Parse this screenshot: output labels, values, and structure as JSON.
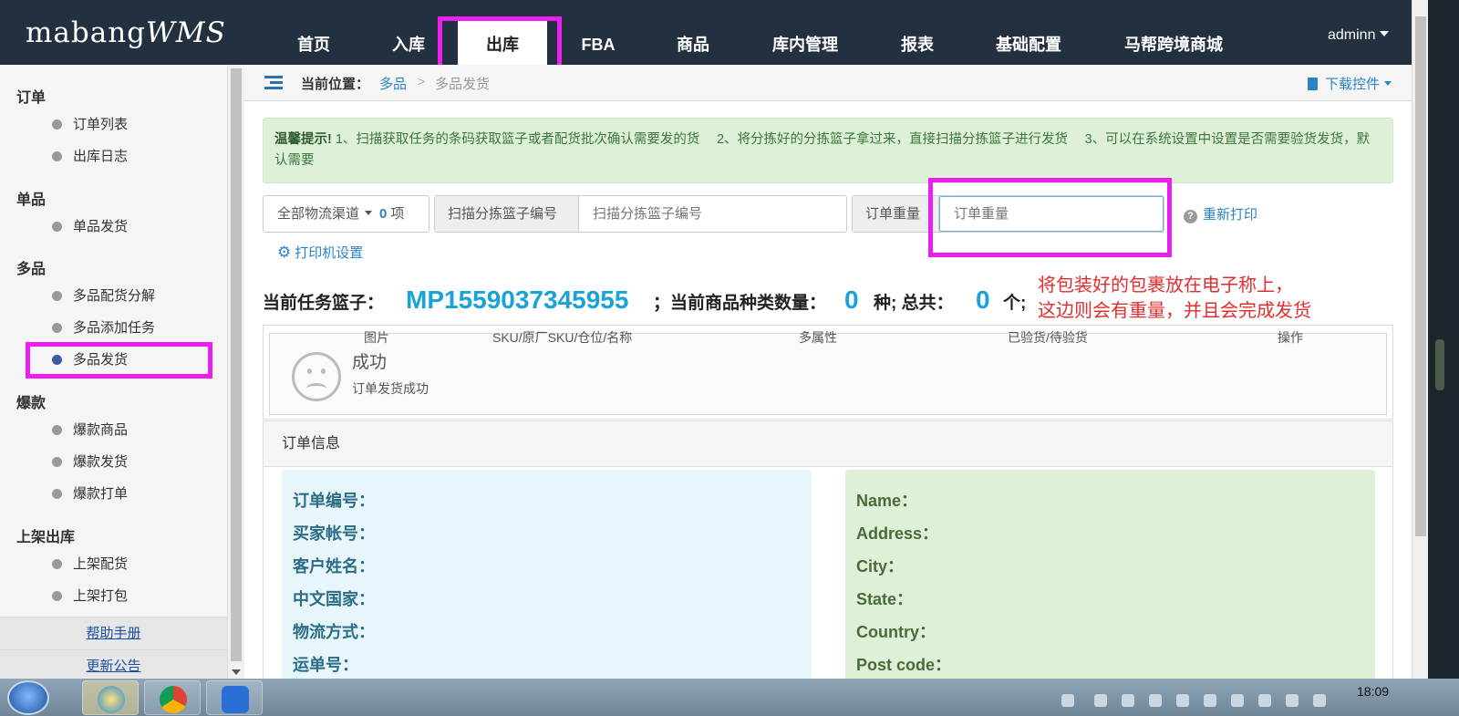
{
  "app": {
    "logo_text": "mabang",
    "logo_italic": "WMS"
  },
  "nav": {
    "items": [
      "首页",
      "入库",
      "出库",
      "FBA",
      "商品",
      "库内管理",
      "报表",
      "基础配置",
      "马帮跨境商城"
    ],
    "active": "出库",
    "user": "adminn"
  },
  "sidebar": {
    "sections": [
      {
        "title": "订单",
        "items": [
          "订单列表",
          "出库日志"
        ]
      },
      {
        "title": "单品",
        "items": [
          "单品发货"
        ]
      },
      {
        "title": "多品",
        "items": [
          "多品配货分解",
          "多品添加任务",
          "多品发货"
        ]
      },
      {
        "title": "爆款",
        "items": [
          "爆款商品",
          "爆款发货",
          "爆款打单"
        ]
      },
      {
        "title": "上架出库",
        "items": [
          "上架配货",
          "上架打包"
        ]
      }
    ],
    "selected": "多品发货",
    "links": [
      "帮助手册",
      "更新公告"
    ]
  },
  "breadcrumb": {
    "label": "当前位置：",
    "items": [
      "多品",
      "多品发货"
    ],
    "separator": ">",
    "download": "下载控件"
  },
  "tip": {
    "title": "温馨提示!",
    "text": " 1、扫描获取任务的条码获取篮子或者配货批次确认需要发的货　 2、将分拣好的分拣篮子拿过来，直接扫描分拣篮子进行发货　 3、可以在系统设置中设置是否需要验货发货，默认需要"
  },
  "controls": {
    "channel": "全部物流渠道",
    "channel_count": "0",
    "channel_unit": "项",
    "basket_addon": "扫描分拣篮子编号",
    "basket_placeholder": "扫描分拣篮子编号",
    "weight_addon": "订单重量",
    "weight_placeholder": "订单重量",
    "reprint": "重新打印",
    "printer": "打印机设置"
  },
  "task": {
    "label": "当前任务篮子：",
    "basket": "MP1559037345955",
    "types_label": "；当前商品种类数量：",
    "types": "0",
    "types_unit": "种; 总共：",
    "total": "0",
    "total_unit": "个;"
  },
  "annotation": "将包装好的包裹放在电子称上，\n这边则会有重量，并且会完成发货",
  "table": {
    "headers": [
      "图片",
      "SKU/原厂SKU/仓位/名称",
      "多属性",
      "已验货/待验货",
      "操作"
    ],
    "status_title": "成功",
    "status_msg": "订单发货成功"
  },
  "order_info": {
    "title": "订单信息",
    "left_fields": [
      "订单编号：",
      "买家帐号：",
      "客户姓名：",
      "中文国家：",
      "物流方式：",
      "运单号："
    ],
    "right_fields": [
      "Name：",
      "Address：",
      "City：",
      "State：",
      "Country：",
      "Post code："
    ]
  },
  "taskbar": {
    "clock": "18:09"
  },
  "colors": {
    "nav_bg": "#23303f",
    "highlight": "#ea1ff0",
    "accent": "#2a84c6",
    "task_value": "#1aa3d6",
    "annotation": "#e22d2d"
  }
}
